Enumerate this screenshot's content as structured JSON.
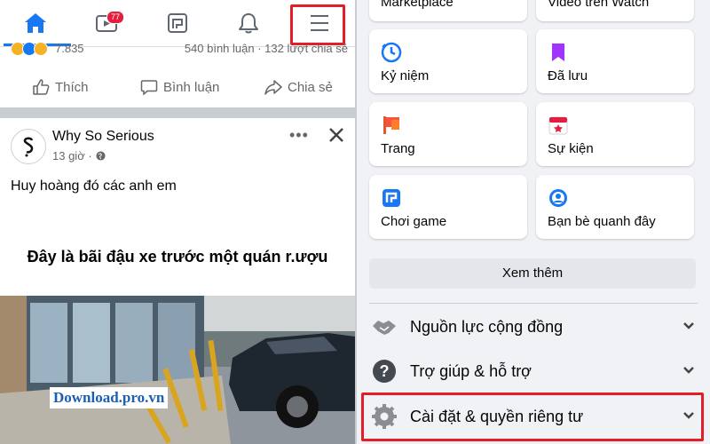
{
  "nav": {
    "watch_badge": "77"
  },
  "post_stats": {
    "reaction_count": "7.835",
    "comments_shares": "540 bình luận · 132 lượt chia sẻ"
  },
  "actions": {
    "like": "Thích",
    "comment": "Bình luận",
    "share": "Chia sẻ"
  },
  "post": {
    "author": "Why So Serious",
    "time": "13 giờ ·",
    "text": "Huy hoàng đó các anh em",
    "headline": "Đây là bãi đậu xe trước một quán r.ượu",
    "watermark": "Download.pro.vn"
  },
  "menu": {
    "top_cards": [
      {
        "label": "Marketplace"
      },
      {
        "label": "Video trên Watch"
      }
    ],
    "cards": [
      {
        "label": "Kỷ niệm",
        "icon": "clock-icon",
        "color": "#1877f2"
      },
      {
        "label": "Đã lưu",
        "icon": "bookmark-icon",
        "color": "#a033ff"
      },
      {
        "label": "Trang",
        "icon": "flag-icon",
        "color": "#f7533e"
      },
      {
        "label": "Sự kiện",
        "icon": "calendar-icon",
        "color": "#e41e3f"
      },
      {
        "label": "Chơi game",
        "icon": "gaming-icon",
        "color": "#1877f2"
      },
      {
        "label": "Bạn bè quanh đây",
        "icon": "nearby-friends-icon",
        "color": "#1877f2"
      }
    ],
    "see_more": "Xem thêm",
    "rows": [
      {
        "label": "Nguồn lực cộng đồng",
        "icon": "handshake-icon"
      },
      {
        "label": "Trợ giúp & hỗ trợ",
        "icon": "help-icon"
      },
      {
        "label": "Cài đặt & quyền riêng tư",
        "icon": "settings-gear-icon"
      }
    ]
  },
  "colors": {
    "accent": "#1877f2",
    "highlight": "#e41e26"
  }
}
